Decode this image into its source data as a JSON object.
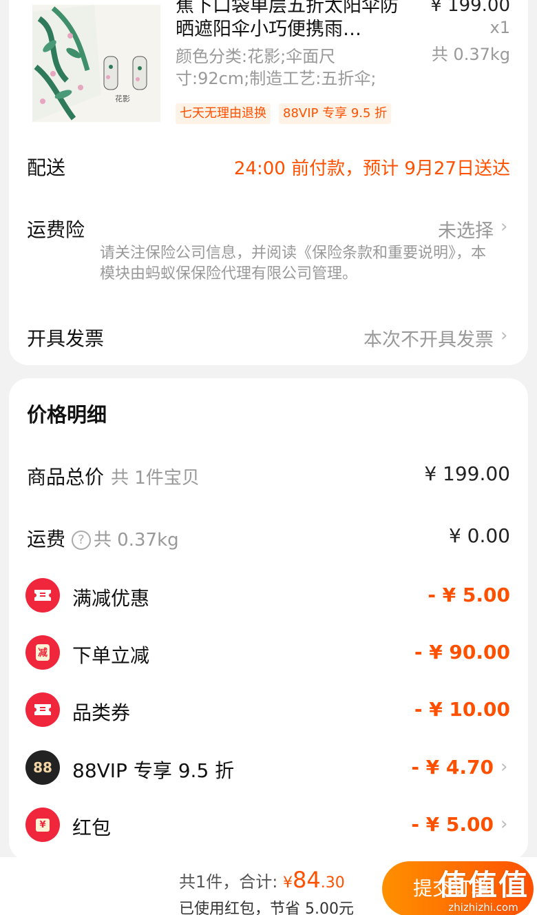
{
  "product": {
    "title": "蕉下口袋单层五折太阳伞防晒遮阳伞小巧便携雨…",
    "spec": "颜色分类:花影;伞面尺寸:92cm;制造工艺:五折伞;",
    "price": "¥ 199.00",
    "qty": "x1",
    "weight": "共 0.37kg",
    "image_caption": "花影",
    "tags": [
      "七天无理由退换",
      "88VIP 专享 9.5 折"
    ]
  },
  "delivery": {
    "label": "配送",
    "value": "24:00 前付款，预计 9月27日送达"
  },
  "insurance": {
    "label": "运费险",
    "value": "未选择",
    "note": "请关注保险公司信息，并阅读《保险条款和重要说明》，本模块由蚂蚁保保险代理有限公司管理。"
  },
  "invoice": {
    "label": "开具发票",
    "value": "本次不开具发票"
  },
  "price_detail": {
    "title": "价格明细",
    "goods_total": {
      "label": "商品总价",
      "sub": "共 1件宝贝",
      "value": "¥ 199.00"
    },
    "shipping": {
      "label": "运费",
      "help": "?",
      "sub": "共 0.37kg",
      "value": "¥ 0.00"
    },
    "discounts": [
      {
        "label": "满减优惠",
        "value": "- ¥ 5.00",
        "icon": "ticket-icon"
      },
      {
        "label": "下单立减",
        "value": "- ¥ 90.00",
        "icon": "reduce-icon",
        "icon_text": "减"
      },
      {
        "label": "品类券",
        "value": "- ¥ 10.00",
        "icon": "ticket-icon"
      },
      {
        "label": "88VIP 专享 9.5 折",
        "value": "- ¥ 4.70",
        "icon": "vip88-icon",
        "icon_text": "88"
      },
      {
        "label": "红包",
        "value": "- ¥ 5.00",
        "icon": "red-packet-icon",
        "icon_text": "¥"
      }
    ]
  },
  "footer": {
    "count": "共1件，合计:",
    "yen": "¥",
    "total_int": "84",
    "total_dec": ".30",
    "saving": "已使用红包，节省 5.00元",
    "submit": "提交订单",
    "watermark_big": "值值值",
    "watermark_small": "zhizhizhi.com"
  },
  "colors": {
    "accent": "#ff5000",
    "red_icon": "#f0263c",
    "gray_text": "#999999"
  }
}
